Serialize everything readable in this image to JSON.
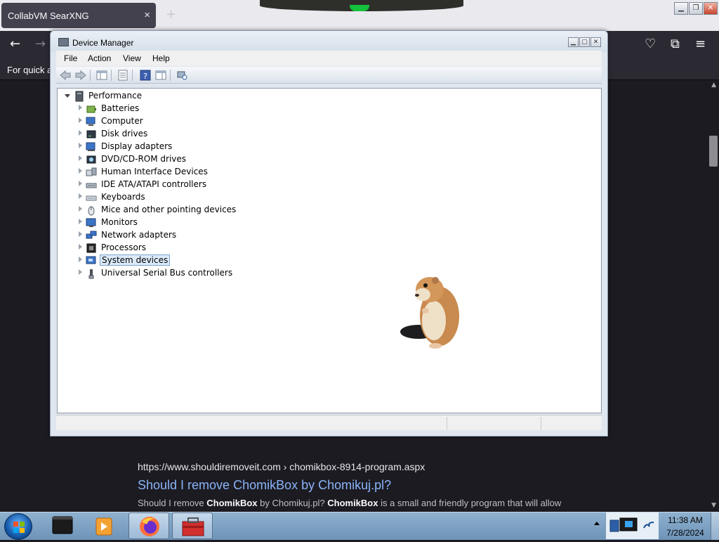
{
  "browser": {
    "tab_title": "CollabVM SearXNG",
    "tab_close": "×",
    "new_tab": "+",
    "bookmarks_hint": "For quick ac",
    "nav": {
      "back": "←",
      "forward": "→",
      "pocket": "♡",
      "extensions": "⧉",
      "menu": "≡"
    }
  },
  "search_result": {
    "url": "https://www.shouldiremoveit.com  › chomikbox-8914-program.aspx",
    "title": "Should I remove ChomikBox by Chomikuj.pl?",
    "snippet_parts": [
      "Should I remove ",
      "ChomikBox",
      " by Chomikuj.pl? ",
      "ChomikBox",
      " is a small and friendly program that will allow"
    ]
  },
  "device_manager": {
    "title": "Device Manager",
    "menu": [
      "File",
      "Action",
      "View",
      "Help"
    ],
    "root": "Performance",
    "nodes": [
      {
        "label": "Batteries",
        "icon": "battery-icon"
      },
      {
        "label": "Computer",
        "icon": "computer-icon"
      },
      {
        "label": "Disk drives",
        "icon": "disk-drive-icon"
      },
      {
        "label": "Display adapters",
        "icon": "display-adapter-icon"
      },
      {
        "label": "DVD/CD-ROM drives",
        "icon": "dvd-drive-icon"
      },
      {
        "label": "Human Interface Devices",
        "icon": "hid-icon"
      },
      {
        "label": "IDE ATA/ATAPI controllers",
        "icon": "ide-controller-icon"
      },
      {
        "label": "Keyboards",
        "icon": "keyboard-icon"
      },
      {
        "label": "Mice and other pointing devices",
        "icon": "mouse-icon"
      },
      {
        "label": "Monitors",
        "icon": "monitor-icon"
      },
      {
        "label": "Network adapters",
        "icon": "network-adapter-icon"
      },
      {
        "label": "Processors",
        "icon": "processor-icon"
      },
      {
        "label": "System devices",
        "icon": "system-devices-icon",
        "selected": true
      },
      {
        "label": "Universal Serial Bus controllers",
        "icon": "usb-icon"
      }
    ]
  },
  "taskbar": {
    "time": "11:38 AM",
    "date": "7/28/2024",
    "apps": [
      "terminal-app",
      "media-player-app",
      "firefox-app",
      "toolbox-app"
    ]
  },
  "colors": {
    "page_bg": "#1c1b22",
    "link": "#8ab4f8",
    "selection": "#dceaf9"
  }
}
